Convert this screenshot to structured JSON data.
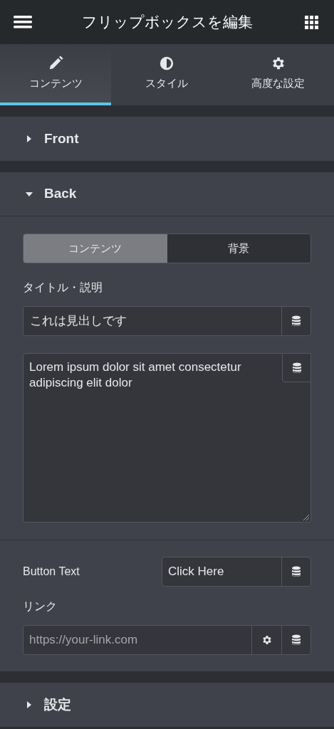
{
  "header": {
    "title": "フリップボックスを編集"
  },
  "tabs": [
    {
      "label": "コンテンツ",
      "kind": "pencil",
      "selected": true
    },
    {
      "label": "スタイル",
      "kind": "contrast",
      "selected": false
    },
    {
      "label": "高度な設定",
      "kind": "gear",
      "selected": false
    }
  ],
  "sections": [
    {
      "title": "Front",
      "expanded": false
    },
    {
      "title": "Back",
      "expanded": true,
      "switcher": [
        {
          "label": "コンテンツ",
          "selected": true
        },
        {
          "label": "背景",
          "selected": false
        }
      ],
      "title_label": "タイトル・説明",
      "title_value": "これは見出しです",
      "description": "Lorem ipsum dolor sit amet consectetur adipiscing elit dolor",
      "button_label": "Button Text",
      "button_value": "Click Here",
      "link_label": "リンク",
      "link_placeholder": "https://your-link.com"
    },
    {
      "title": "設定",
      "expanded": false
    }
  ]
}
